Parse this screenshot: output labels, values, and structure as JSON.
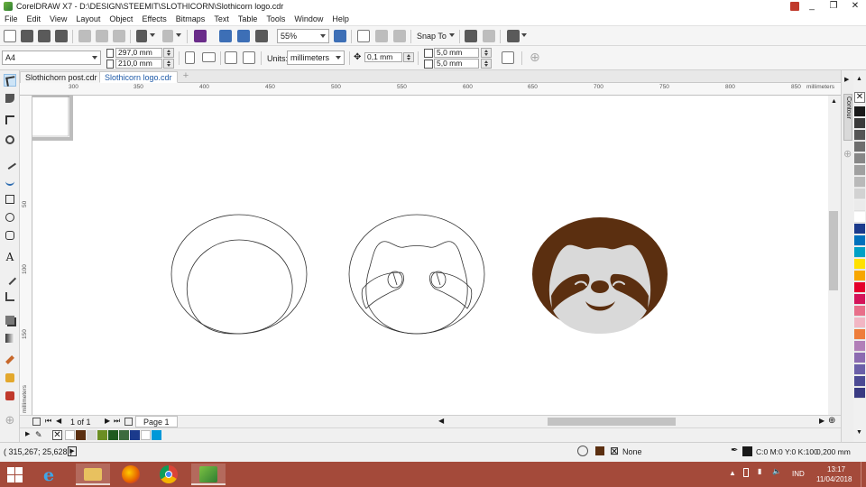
{
  "window": {
    "title": "CorelDRAW X7 - D:\\DESIGN\\STEEMIT\\SLOTHICORN\\Slothicorn logo.cdr",
    "controls": {
      "minimize": "_",
      "restore": "❐",
      "close": "✕"
    }
  },
  "menu": [
    "File",
    "Edit",
    "View",
    "Layout",
    "Object",
    "Effects",
    "Bitmaps",
    "Text",
    "Table",
    "Tools",
    "Window",
    "Help"
  ],
  "toolbar": {
    "zoom": "55%",
    "snap_to": "Snap To"
  },
  "property_bar": {
    "page_size": "A4",
    "width": "297,0 mm",
    "height": "210,0 mm",
    "units_label": "Units:",
    "units_value": "millimeters",
    "nudge": "0,1 mm",
    "dup_x": "5,0 mm",
    "dup_y": "5,0 mm"
  },
  "tabs": [
    {
      "label": "Slothichorn post.cdr",
      "active": false
    },
    {
      "label": "Slothicorn logo.cdr",
      "active": true
    }
  ],
  "ruler": {
    "h_labels": [
      "300",
      "350",
      "400",
      "450",
      "500",
      "550",
      "600",
      "650",
      "700",
      "750",
      "800",
      "850"
    ],
    "h_unit": "millimeters",
    "v_labels": [
      "50",
      "100",
      "150"
    ],
    "v_unit": "millimeters"
  },
  "docker": {
    "tab_label": "Contour"
  },
  "page_nav": {
    "counter": "1 of 1",
    "page_tab": "Page 1"
  },
  "colors": {
    "sloth_brown": "#5b2f10",
    "sloth_face": "#d9d9d9",
    "palette": [
      "#1a1a1a",
      "#3a3a3a",
      "#555555",
      "#6e6e6e",
      "#878787",
      "#a0a0a0",
      "#b9b9b9",
      "#d2d2d2",
      "#ebebeb",
      "#ffffff",
      "#1b3a8c",
      "#0071bc",
      "#00a0c6",
      "#ffe100",
      "#f7a600",
      "#e4002b",
      "#d4145a",
      "#e86f8a",
      "#f2b6c4",
      "#ee7d3b",
      "#b27fb8",
      "#8c6bb1",
      "#6b5fa8",
      "#4c4a94",
      "#393a82"
    ],
    "doc_palette": [
      "#ffffff",
      "#5b2f10",
      "#d9d9d9",
      "#6b8e23",
      "#1e5a1e",
      "#3d6b3d",
      "#1b3a8c",
      "#ffffff",
      "#0098d8"
    ]
  },
  "status": {
    "coords": "( 315,267; 25,628 )",
    "fill_none": "None",
    "outline_color": "C:0 M:0 Y:0 K:100",
    "outline_width": "0,200 mm"
  },
  "taskbar": {
    "lang": "IND",
    "time": "13:17",
    "date": "11/04/2018"
  }
}
